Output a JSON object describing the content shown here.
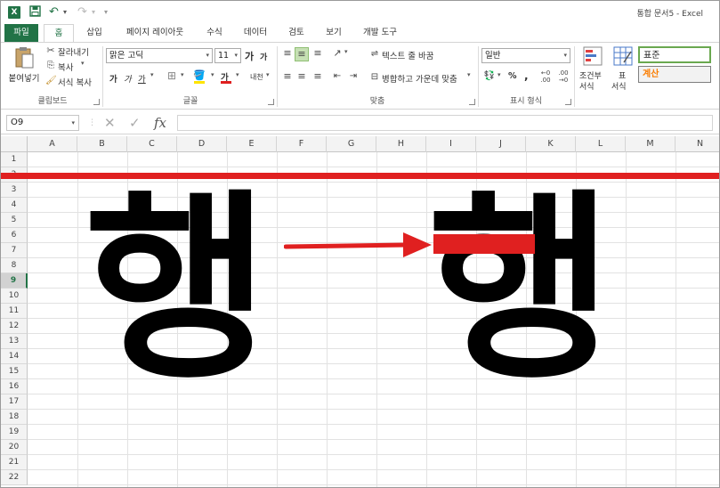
{
  "window": {
    "app_icon_text": "X",
    "title": "통합 문서5 - Excel"
  },
  "qat": {
    "save_icon": "💾",
    "undo_icon": "↶",
    "redo_icon": "↷",
    "customize_icon": "▾"
  },
  "tabs": [
    {
      "label": "파일"
    },
    {
      "label": "홈"
    },
    {
      "label": "삽입"
    },
    {
      "label": "페이지 레이아웃"
    },
    {
      "label": "수식"
    },
    {
      "label": "데이터"
    },
    {
      "label": "검토"
    },
    {
      "label": "보기"
    },
    {
      "label": "개발 도구"
    }
  ],
  "ribbon": {
    "clipboard": {
      "paste_label": "붙여넣기",
      "cut_label": "잘라내기",
      "copy_label": "복사",
      "format_painter_label": "서식 복사",
      "group_label": "클립보드"
    },
    "font": {
      "font_name": "맑은 고딕",
      "font_size": "11",
      "grow_label": "가",
      "shrink_label": "가",
      "bold_label": "가",
      "italic_label": "가",
      "underline_label": "가",
      "font_color_label": "가",
      "phonetic_label": "내천",
      "group_label": "글꼴"
    },
    "alignment": {
      "wrap_text_label": "텍스트 줄 바꿈",
      "merge_center_label": "병합하고 가운데 맞춤",
      "group_label": "맞춤"
    },
    "number": {
      "format_value": "일반",
      "percent_label": "%",
      "comma_label": ",",
      "group_label": "표시 형식"
    },
    "styles": {
      "conditional_label_1": "조건부",
      "conditional_label_2": "서식",
      "table_label_1": "표",
      "table_label_2": "서식",
      "style_normal": "표준",
      "style_calc": "계산"
    }
  },
  "formula_bar": {
    "name_box": "O9",
    "cancel_icon": "✕",
    "enter_icon": "✓",
    "fx_label": "fx",
    "formula_value": ""
  },
  "columns": [
    "A",
    "B",
    "C",
    "D",
    "E",
    "F",
    "G",
    "H",
    "I",
    "J",
    "K",
    "L",
    "M",
    "N"
  ],
  "rows": [
    "1",
    "2",
    "3",
    "4",
    "5",
    "6",
    "7",
    "8",
    "9",
    "10",
    "11",
    "12",
    "13",
    "14",
    "15",
    "16",
    "17",
    "18",
    "19",
    "20",
    "21",
    "22"
  ],
  "active_row": "9",
  "overlay": {
    "left_char": "행",
    "right_char": "행",
    "arrow_color": "#e02020",
    "line_color": "#e02020"
  }
}
